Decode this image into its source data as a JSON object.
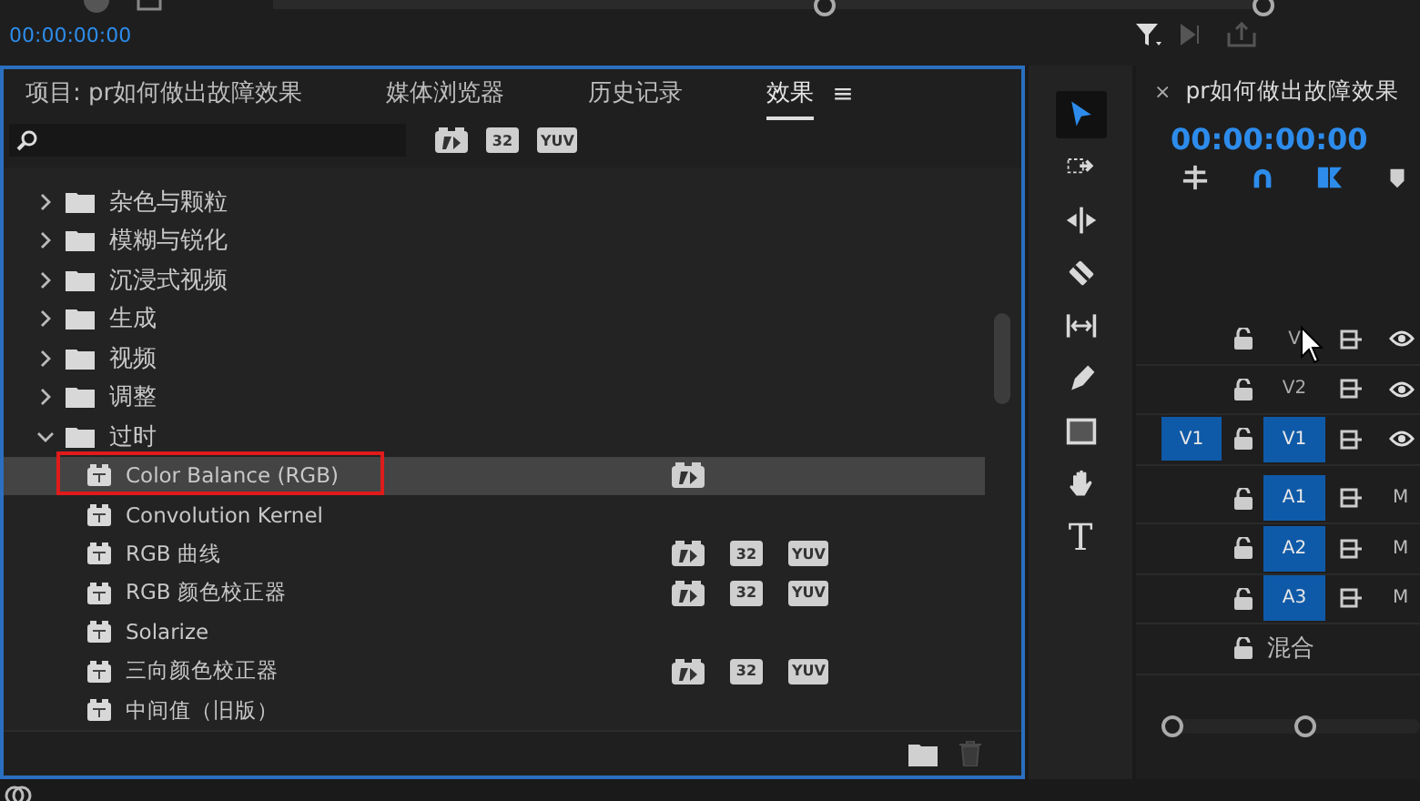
{
  "program_monitor": {
    "timecode": "00:00:00:00"
  },
  "effects_panel": {
    "tabs": [
      {
        "label": "项目: pr如何做出故障效果",
        "selected": false
      },
      {
        "label": "媒体浏览器",
        "selected": false
      },
      {
        "label": "历史记录",
        "selected": false
      },
      {
        "label": "效果",
        "selected": true
      }
    ],
    "menu_glyph": "≡",
    "filters": [
      {
        "kind": "accelerated"
      },
      {
        "kind": "label",
        "text": "32"
      },
      {
        "kind": "label",
        "text": "YUV"
      }
    ],
    "tree": [
      {
        "label": "杂色与颗粒",
        "expanded": false
      },
      {
        "label": "模糊与锐化",
        "expanded": false
      },
      {
        "label": "沉浸式视频",
        "expanded": false
      },
      {
        "label": "生成",
        "expanded": false
      },
      {
        "label": "视频",
        "expanded": false
      },
      {
        "label": "调整",
        "expanded": false
      },
      {
        "label": "过时",
        "expanded": true,
        "children": [
          {
            "label": "Color Balance (RGB)",
            "selected": true,
            "highlighted": true,
            "badges": [
              {
                "kind": "accelerated"
              }
            ]
          },
          {
            "label": "Convolution Kernel",
            "selected": false,
            "highlighted": false
          },
          {
            "label": "RGB 曲线",
            "selected": false,
            "highlighted": false,
            "badges": [
              {
                "kind": "accelerated"
              },
              {
                "kind": "label",
                "text": "32"
              },
              {
                "kind": "label",
                "text": "YUV"
              }
            ]
          },
          {
            "label": "RGB 颜色校正器",
            "selected": false,
            "highlighted": false,
            "badges": [
              {
                "kind": "accelerated"
              },
              {
                "kind": "label",
                "text": "32"
              },
              {
                "kind": "label",
                "text": "YUV"
              }
            ]
          },
          {
            "label": "Solarize",
            "selected": false,
            "highlighted": false
          },
          {
            "label": "三向颜色校正器",
            "selected": false,
            "highlighted": false,
            "badges": [
              {
                "kind": "accelerated"
              },
              {
                "kind": "label",
                "text": "32"
              },
              {
                "kind": "label",
                "text": "YUV"
              }
            ]
          },
          {
            "label": "中间值（旧版）",
            "selected": false,
            "highlighted": false
          }
        ]
      }
    ]
  },
  "tools": [
    {
      "kind": "selection",
      "selected": true
    },
    {
      "kind": "track-select",
      "selected": false
    },
    {
      "kind": "ripple",
      "selected": false
    },
    {
      "kind": "razor",
      "selected": false
    },
    {
      "kind": "slip",
      "selected": false
    },
    {
      "kind": "pen",
      "selected": false
    },
    {
      "kind": "rectangle",
      "selected": false
    },
    {
      "kind": "hand",
      "selected": false
    },
    {
      "kind": "type",
      "selected": false,
      "glyph": "T"
    }
  ],
  "timeline": {
    "close_glyph": "×",
    "title": "pr如何做出故障效果",
    "timecode": "00:00:00:00",
    "toolbar": [
      {
        "kind": "nest",
        "on": false
      },
      {
        "kind": "snap",
        "on": true
      },
      {
        "kind": "linked",
        "on": true
      },
      {
        "kind": "marker",
        "on": false
      }
    ],
    "tracks": [
      {
        "kind": "video",
        "label": "V",
        "targeted": false
      },
      {
        "kind": "video",
        "label": "V2",
        "targeted": false
      },
      {
        "kind": "video",
        "label": "V1",
        "targeted": true,
        "source": "V1"
      },
      {
        "kind": "audio",
        "label": "A1",
        "targeted": true,
        "mute_glyph": "M"
      },
      {
        "kind": "audio",
        "label": "A2",
        "targeted": true,
        "mute_glyph": "M"
      },
      {
        "kind": "audio",
        "label": "A3",
        "targeted": true,
        "mute_glyph": "M"
      },
      {
        "kind": "mix",
        "label": "混合"
      }
    ]
  }
}
